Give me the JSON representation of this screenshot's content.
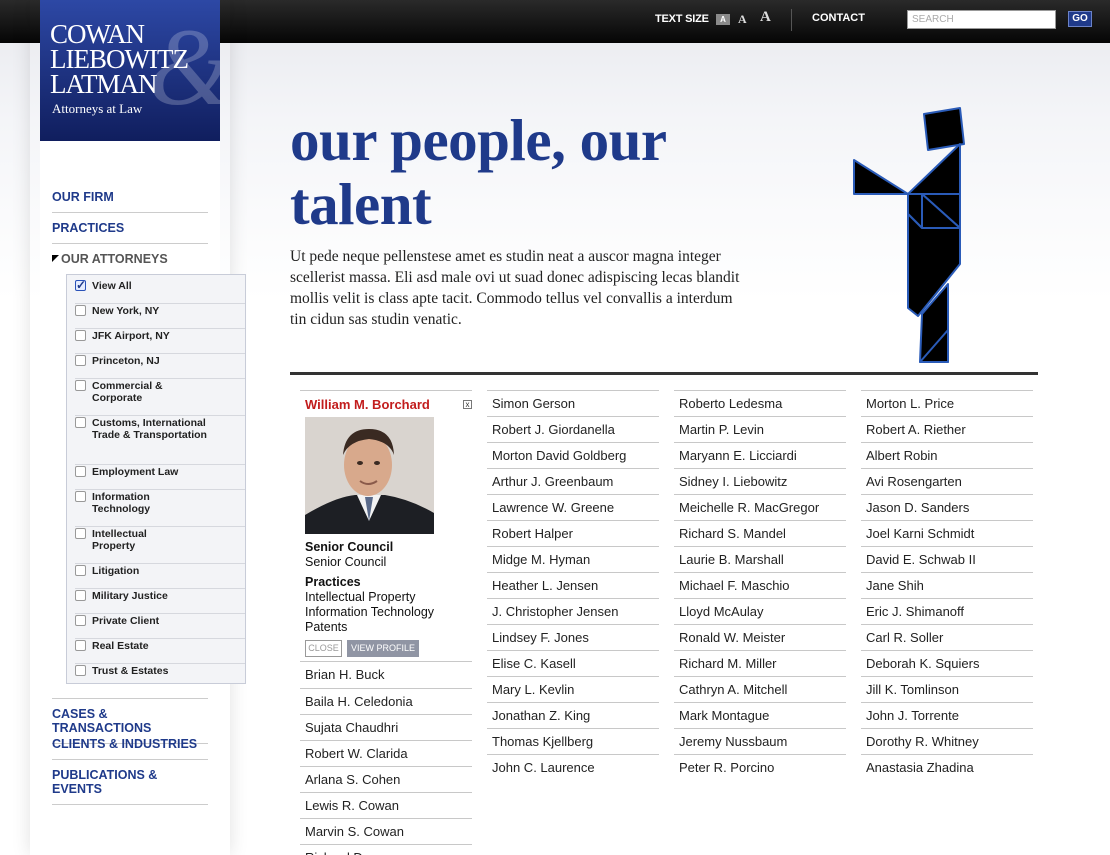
{
  "topbar": {
    "text_size_label": "TEXT SIZE",
    "size_small": "A",
    "size_medium": "A",
    "size_large": "A",
    "contact": "CONTACT",
    "search_placeholder": "SEARCH",
    "go": "GO"
  },
  "logo": {
    "line1": "COWAN",
    "line2": "LIEBOWITZ",
    "line3": "LATMAN",
    "ampersand": "&",
    "sub": "Attorneys at Law"
  },
  "nav": {
    "our_firm": "OUR FIRM",
    "practices": "PRACTICES",
    "our_attorneys": "OUR ATTORNEYS",
    "cases": "CASES & TRANSACTIONS",
    "clients": "CLIENTS & INDUSTRIES",
    "publications": "PUBLICATIONS & EVENTS"
  },
  "filters": [
    {
      "label": "View All",
      "checked": true
    },
    {
      "label": "New York, NY",
      "checked": false
    },
    {
      "label": "JFK Airport, NY",
      "checked": false
    },
    {
      "label": "Princeton, NJ",
      "checked": false
    },
    {
      "label": "Commercial & Corporate",
      "checked": false
    },
    {
      "label": "Customs, International Trade & Transportation",
      "checked": false
    },
    {
      "label": "Employment Law",
      "checked": false
    },
    {
      "label": "Information Technology",
      "checked": false
    },
    {
      "label": "Intellectual Property",
      "checked": false
    },
    {
      "label": "Litigation",
      "checked": false
    },
    {
      "label": "Military Justice",
      "checked": false
    },
    {
      "label": "Private Client",
      "checked": false
    },
    {
      "label": "Real Estate",
      "checked": false
    },
    {
      "label": "Trust & Estates",
      "checked": false
    }
  ],
  "main": {
    "headline": "our people, our talent",
    "intro": "Ut pede neque pellenstese amet es studin neat a auscor magna integer scellerist massa. Eli asd male ovi ut suad donec adispiscing lecas blandit mollis velit is class apte tacit. Commodo tellus vel convallis a interdum tin cidun sas studin venatic."
  },
  "card": {
    "name": "William M. Borchard",
    "close_x": "x",
    "title_heading": "Senior Council",
    "title": "Senior Council",
    "practices_heading": "Practices",
    "practices": [
      "Intellectual Property",
      "Information Technology",
      "Patents"
    ],
    "close_button": "CLOSE",
    "view_profile_button": "VIEW PROFILE"
  },
  "attorneys": {
    "col1": [
      "Brian H. Buck",
      "Baila H. Celedonia",
      "Sujata Chaudhri",
      "Robert W. Clarida",
      "Arlana S. Cohen",
      "Lewis R. Cowan",
      "Marvin S. Cowan",
      "Richard Dannay"
    ],
    "col2": [
      "Simon Gerson",
      "Robert J. Giordanella",
      "Morton David Goldberg",
      "Arthur J. Greenbaum",
      "Lawrence W. Greene",
      "Robert Halper",
      "Midge M. Hyman",
      "Heather L. Jensen",
      "J. Christopher Jensen",
      "Lindsey F. Jones",
      "Elise C. Kasell",
      "Mary L. Kevlin",
      "Jonathan Z. King",
      "Thomas Kjellberg",
      "John C. Laurence"
    ],
    "col3": [
      "Roberto Ledesma",
      "Martin P. Levin",
      "Maryann E. Licciardi",
      "Sidney I. Liebowitz",
      "Meichelle R. MacGregor",
      "Richard S. Mandel",
      "Laurie B. Marshall",
      "Michael F. Maschio",
      "Lloyd McAulay",
      "Ronald W. Meister",
      "Richard M. Miller",
      "Cathryn A. Mitchell",
      "Mark Montague",
      "Jeremy Nussbaum",
      "Peter R. Porcino"
    ],
    "col4": [
      "Morton L. Price",
      "Robert A. Riether",
      "Albert Robin",
      "Avi Rosengarten",
      "Jason D. Sanders",
      "Joel Karni Schmidt",
      "David E. Schwab II",
      "Jane Shih",
      "Eric J. Shimanoff",
      "Carl R. Soller",
      "Deborah K. Squiers",
      "Jill K. Tomlinson",
      "John J. Torrente",
      "Dorothy R. Whitney",
      "Anastasia Zhadina"
    ]
  },
  "colors": {
    "brand_blue": "#1f3a8a",
    "highlight_red": "#c21d1d",
    "figure_stroke": "#2a5bb8"
  }
}
